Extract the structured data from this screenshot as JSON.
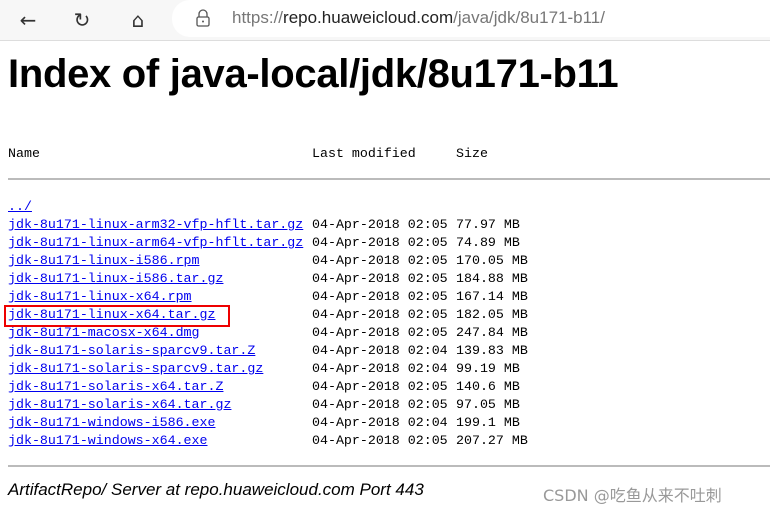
{
  "browser": {
    "url_scheme": "https://",
    "url_host": "repo.huaweicloud.com",
    "url_path": "/java/jdk/8u171-b11/",
    "icons": [
      "back-arrow-icon",
      "reload-icon",
      "home-icon",
      "lock-icon"
    ]
  },
  "page": {
    "title": "Index of java-local/jdk/8u171-b11",
    "columns": {
      "name": "Name",
      "modified": "Last modified",
      "size": "Size"
    },
    "parent_link": "../",
    "files": [
      {
        "name": "jdk-8u171-linux-arm32-vfp-hflt.tar.gz",
        "modified": "04-Apr-2018 02:05",
        "size": "77.97 MB"
      },
      {
        "name": "jdk-8u171-linux-arm64-vfp-hflt.tar.gz",
        "modified": "04-Apr-2018 02:05",
        "size": "74.89 MB"
      },
      {
        "name": "jdk-8u171-linux-i586.rpm",
        "modified": "04-Apr-2018 02:05",
        "size": "170.05 MB"
      },
      {
        "name": "jdk-8u171-linux-i586.tar.gz",
        "modified": "04-Apr-2018 02:05",
        "size": "184.88 MB"
      },
      {
        "name": "jdk-8u171-linux-x64.rpm",
        "modified": "04-Apr-2018 02:05",
        "size": "167.14 MB"
      },
      {
        "name": "jdk-8u171-linux-x64.tar.gz",
        "modified": "04-Apr-2018 02:05",
        "size": "182.05 MB",
        "highlighted": true
      },
      {
        "name": "jdk-8u171-macosx-x64.dmg",
        "modified": "04-Apr-2018 02:05",
        "size": "247.84 MB"
      },
      {
        "name": "jdk-8u171-solaris-sparcv9.tar.Z",
        "modified": "04-Apr-2018 02:04",
        "size": "139.83 MB"
      },
      {
        "name": "jdk-8u171-solaris-sparcv9.tar.gz",
        "modified": "04-Apr-2018 02:04",
        "size": "99.19 MB"
      },
      {
        "name": "jdk-8u171-solaris-x64.tar.Z",
        "modified": "04-Apr-2018 02:05",
        "size": "140.6 MB"
      },
      {
        "name": "jdk-8u171-solaris-x64.tar.gz",
        "modified": "04-Apr-2018 02:05",
        "size": "97.05 MB"
      },
      {
        "name": "jdk-8u171-windows-i586.exe",
        "modified": "04-Apr-2018 02:04",
        "size": "199.1 MB"
      },
      {
        "name": "jdk-8u171-windows-x64.exe",
        "modified": "04-Apr-2018 02:05",
        "size": "207.27 MB"
      }
    ],
    "footer": "ArtifactRepo/ Server at repo.huaweicloud.com Port 443",
    "highlight_color": "#ee0000",
    "link_color": "#0000ee"
  },
  "watermark": "CSDN @吃鱼从来不吐刺"
}
